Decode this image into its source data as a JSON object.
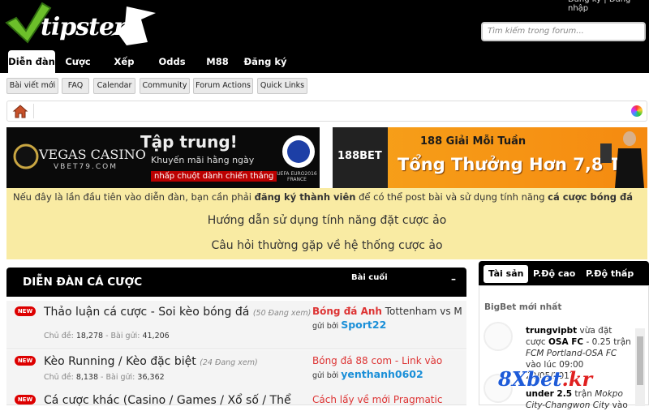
{
  "header": {
    "logo_text": "tipster",
    "search_placeholder": "Tìm kiếm trong forum...",
    "top_link": "Đăng ký | Đăng nhập",
    "tabs": [
      {
        "label": "Diễn đàn"
      },
      {
        "label": "Cược ảo"
      },
      {
        "label": "Xếp hạng"
      },
      {
        "label": "Odds"
      },
      {
        "label": "M88"
      },
      {
        "label": "Đăng ký"
      }
    ]
  },
  "subnav": [
    {
      "label": "Bài viết mới"
    },
    {
      "label": "FAQ"
    },
    {
      "label": "Calendar"
    },
    {
      "label": "Community"
    },
    {
      "label": "Forum Actions"
    },
    {
      "label": "Quick Links"
    }
  ],
  "banner1": {
    "brand": "VEGAS CASINO",
    "url": "VBET79.COM",
    "headline": "Tập trung!",
    "sub": "Khuyến mãi hằng ngày",
    "cta": "nhấp chuột dành chiến thắng",
    "badge": "UEFA EURO2016 FRANCE"
  },
  "banner2": {
    "brand": "188BET",
    "line1": "188 Giải Mỗi Tuần",
    "line2": "Tổng Thưởng Hơn 7,8 Tỷ!"
  },
  "notice": {
    "prefix": "Nếu đây là lần đầu tiên vào diễn đàn, bạn cần phải ",
    "link1": "đăng ký thành viên",
    "middle": " để có thể post bài và sử dụng tính năng ",
    "link2": "cá cược bóng đá",
    "guide": "Hướng dẫn sử dụng tính năng đặt cược ảo",
    "faq": "Câu hỏi thường gặp về hệ thống cược ảo"
  },
  "forum": {
    "title": "DIỄN ĐÀN CÁ CƯỢC",
    "col_last": "Bài cuối",
    "minimize": "–",
    "new_badge": "NEW",
    "threads_label": "Chủ đề:",
    "posts_label": "- Bài gửi:",
    "by_label": "gửi bởi",
    "rows": [
      {
        "title": "Thảo luận cá cược - Soi kèo bóng đá",
        "viewing": "(50 Đang xem)",
        "threads": "18,278",
        "posts": "41,206",
        "last_red": "Bóng đá Anh",
        "last_black": " Tottenham vs Man U",
        "last_by": "Sport22"
      },
      {
        "title": "Kèo Running / Kèo đặc biệt",
        "viewing": "(24 Đang xem)",
        "threads": "8,138",
        "posts": "36,362",
        "last_red": "Bóng đá 88 com - Link vào",
        "last_black": "",
        "last_by": "yenthanh0602"
      },
      {
        "title": "Cá cược khác (Casino / Games / Xổ số / Thể",
        "viewing": "",
        "threads": "",
        "posts": "",
        "last_red": "Cách lấy về mới Pragmatic",
        "last_black": "",
        "last_by": ""
      }
    ]
  },
  "sidebar": {
    "tabs": [
      {
        "label": "Tài sản"
      },
      {
        "label": "P.Độ cao"
      },
      {
        "label": "P.Độ thấp"
      }
    ],
    "title": "BigBet mới nhất",
    "entries": [
      {
        "user": "trungvipbt",
        "text1": " vừa đặt cược ",
        "team": "OSA FC",
        "text2": " - 0.25 trận ",
        "match": "FCM Portland-OSA FC",
        "text3": " vào lúc 09:00 20/05/2017"
      },
      {
        "user": "",
        "text1": "",
        "team": "under 2.5",
        "text2": " trận ",
        "match": "Mokpo City-Changwon City",
        "text3": " vào"
      }
    ]
  },
  "watermark": {
    "main": "8Xbet",
    "suffix": ".kr"
  }
}
